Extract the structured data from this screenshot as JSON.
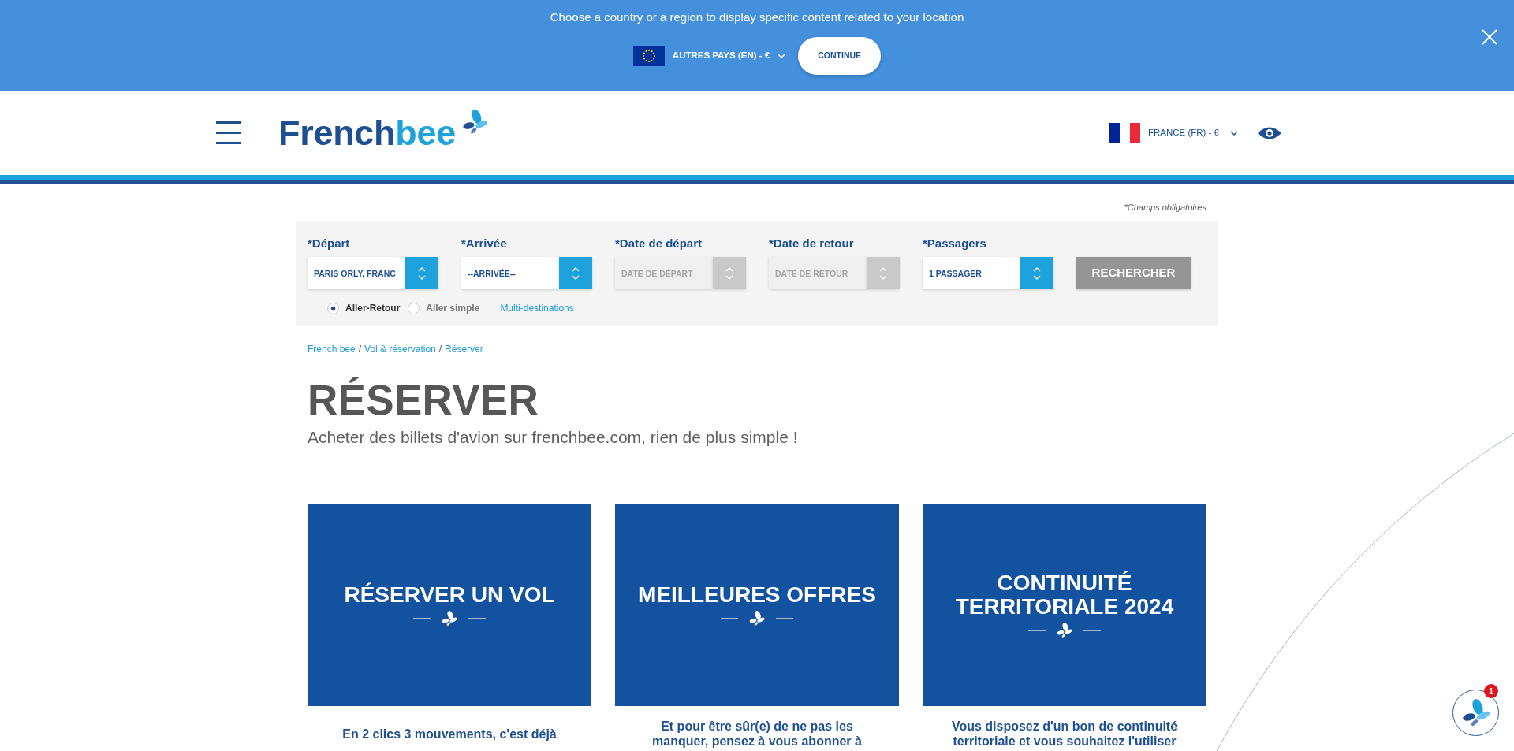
{
  "location_banner": {
    "message": "Choose a country or a region to display specific content related to your location",
    "region": "AUTRES PAYS (EN) - €",
    "continue_button": "CONTINUE"
  },
  "header": {
    "logo": {
      "dark": "French",
      "light": "bee"
    },
    "language": "FRANCE (FR) - €"
  },
  "search_form": {
    "required_note": "*Champs obligatoires",
    "fields": [
      {
        "label": "*Départ",
        "value": "PARIS ORLY, FRANC",
        "disabled": false
      },
      {
        "label": "*Arrivée",
        "value": "--ARRIVÉE--",
        "disabled": false
      },
      {
        "label": "*Date de départ",
        "placeholder": "DATE DE DÉPART",
        "disabled": true
      },
      {
        "label": "*Date de retour",
        "placeholder": "DATE DE RETOUR",
        "disabled": true
      },
      {
        "label": "*Passagers",
        "value": "1 PASSAGER",
        "disabled": false
      }
    ],
    "search_button": {
      "label": "RECHERCHER",
      "disabled": true
    },
    "trip_types": [
      {
        "label": "Aller-Retour",
        "selected": true
      },
      {
        "label": "Aller simple",
        "selected": false
      }
    ],
    "multi_destinations_link": "Multi-destinations"
  },
  "breadcrumb": {
    "items": [
      "French bee",
      "Vol & réservation",
      "Réserver"
    ],
    "separators": [
      "/",
      "/"
    ]
  },
  "page_title": "RÉSERVER",
  "page_subtitle": "Acheter des billets d'avion sur frenchbee.com, rien de plus simple !",
  "cards": [
    {
      "title": "RÉSERVER UN VOL",
      "description": "En 2 clics 3 mouvements, c'est déjà"
    },
    {
      "title": "MEILLEURES OFFRES",
      "description": "Et pour être sûr(e) de ne pas les\nmanquer, pensez à vous abonner à"
    },
    {
      "title": "CONTINUITÉ TERRITORIALE 2024",
      "description": "Vous disposez d'un bon de continuité\nterritoriale et vous souhaitez l'utiliser"
    }
  ],
  "chat_widget": {
    "badge": "1"
  }
}
